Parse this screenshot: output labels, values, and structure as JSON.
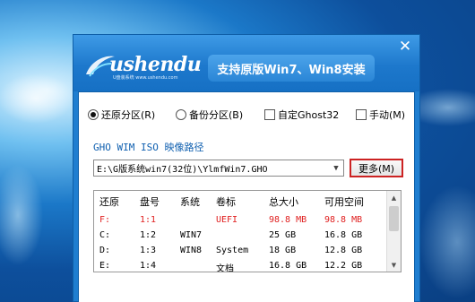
{
  "window": {
    "logo_text": "ushendu",
    "logo_sub": "U盘装系统  www.ushendu.com",
    "title": "支持原版Win7、Win8安装",
    "close_icon": "close-icon"
  },
  "options": [
    {
      "label": "还原分区(R)",
      "type": "radio",
      "checked": true
    },
    {
      "label": "备份分区(B)",
      "type": "radio",
      "checked": false
    },
    {
      "label": "自定Ghost32",
      "type": "checkbox",
      "checked": false
    },
    {
      "label": "手动(M)",
      "type": "checkbox",
      "checked": false
    }
  ],
  "image_path": {
    "label": "GHO WIM ISO 映像路径",
    "value": "E:\\G版系统win7(32位)\\YlmfWin7.GHO",
    "more_button": "更多(M)"
  },
  "partition_table": {
    "columns": [
      "还原",
      "盘号",
      "系统",
      "卷标",
      "总大小",
      "可用空间"
    ],
    "rows": [
      [
        "F:",
        "1:1",
        "",
        "UEFI",
        "98.8 MB",
        "98.8 MB"
      ],
      [
        "C:",
        "1:2",
        "WIN7",
        "",
        "25 GB",
        "16.8 GB"
      ],
      [
        "D:",
        "1:3",
        "WIN8",
        "System",
        "18 GB",
        "12.8 GB"
      ],
      [
        "E:",
        "1:4",
        "",
        "文档",
        "16.8 GB",
        "12.2 GB"
      ]
    ],
    "highlight_row_color": "#e02020"
  },
  "colors": {
    "titlebar": "#1d78cc",
    "accent_border": "#cc2222"
  }
}
